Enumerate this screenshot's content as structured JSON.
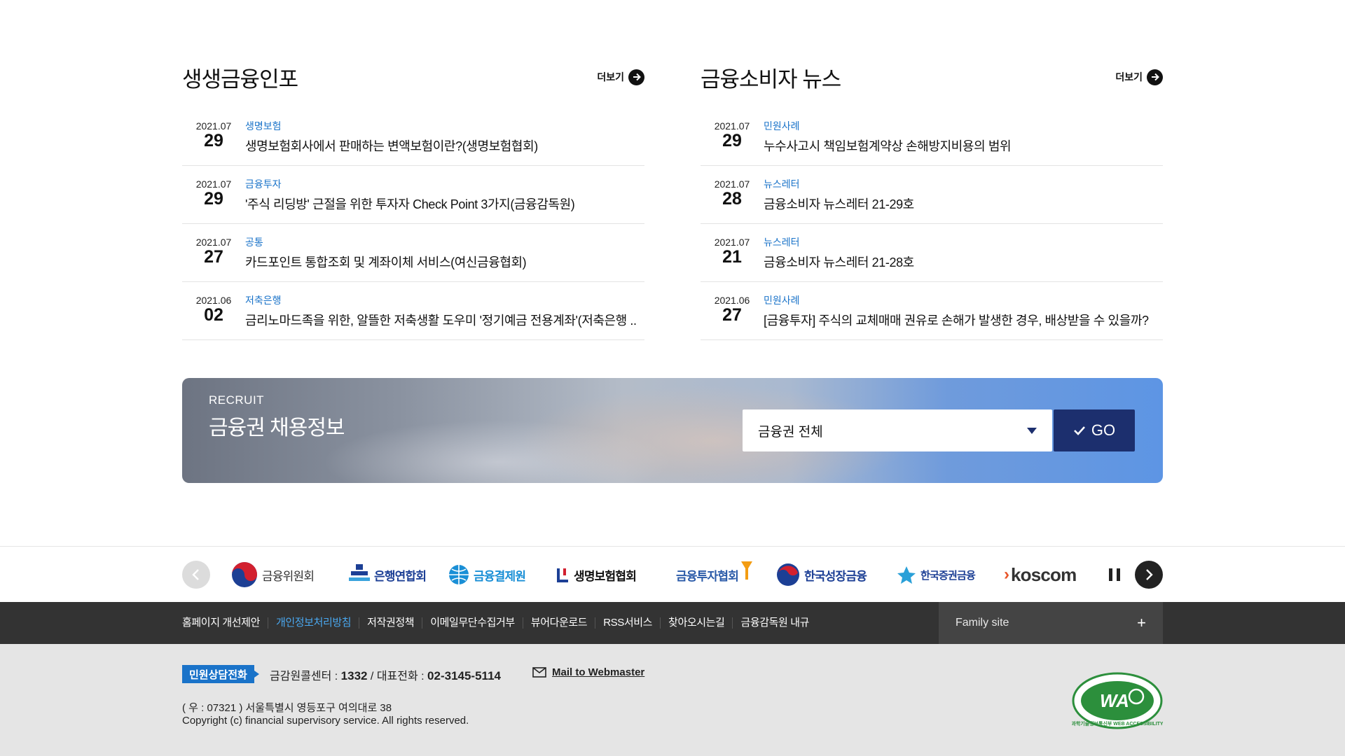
{
  "left_news": {
    "title": "생생금융인포",
    "more_label": "더보기",
    "items": [
      {
        "ym": "2021.07",
        "day": "29",
        "category": "생명보험",
        "text": "생명보험회사에서 판매하는 변액보험이란?(생명보험협회)"
      },
      {
        "ym": "2021.07",
        "day": "29",
        "category": "금융투자",
        "text": "'주식 리딩방' 근절을 위한 투자자 Check Point 3가지(금융감독원)"
      },
      {
        "ym": "2021.07",
        "day": "27",
        "category": "공통",
        "text": "카드포인트 통합조회 및 계좌이체 서비스(여신금융협회)"
      },
      {
        "ym": "2021.06",
        "day": "02",
        "category": "저축은행",
        "text": "금리노마드족을 위한, 알뜰한 저축생활 도우미 '정기예금 전용계좌'(저축은행 .."
      }
    ]
  },
  "right_news": {
    "title": "금융소비자 뉴스",
    "more_label": "더보기",
    "items": [
      {
        "ym": "2021.07",
        "day": "29",
        "category": "민원사례",
        "text": "누수사고시 책임보험계약상 손해방지비용의 범위"
      },
      {
        "ym": "2021.07",
        "day": "28",
        "category": "뉴스레터",
        "text": "금융소비자 뉴스레터 21-29호"
      },
      {
        "ym": "2021.07",
        "day": "21",
        "category": "뉴스레터",
        "text": "금융소비자 뉴스레터 21-28호"
      },
      {
        "ym": "2021.06",
        "day": "27",
        "category": "민원사례",
        "text": "[금융투자] 주식의 교체매매 권유로 손해가 발생한 경우, 배상받을 수 있을까?"
      }
    ]
  },
  "recruit": {
    "subtitle": "RECRUIT",
    "title": "금융권 채용정보",
    "select_value": "금융권 전체",
    "go_label": "GO"
  },
  "partners": {
    "logos": [
      {
        "name": "금융위원회",
        "color": "#333333"
      },
      {
        "name": "은행연합회",
        "color": "#1c3f95"
      },
      {
        "name": "금융결제원",
        "color": "#1a8fd6"
      },
      {
        "name": "생명보험협회",
        "color": "#111111"
      },
      {
        "name": "금융투자협회",
        "color": "#2a5aa8"
      },
      {
        "name": "한국성장금융",
        "color": "#1c3f95"
      },
      {
        "name": "한국증권금융",
        "color": "#1c3f95"
      },
      {
        "name": "koscom",
        "color": "#333333"
      }
    ]
  },
  "footer_nav": {
    "links": [
      "홈페이지 개선제안",
      "개인정보처리방침",
      "저작권정책",
      "이메일무단수집거부",
      "뷰어다운로드",
      "RSS서비스",
      "찾아오시는길",
      "금융감독원 내규"
    ],
    "family_site": "Family site",
    "family_plus": "+"
  },
  "footer_info": {
    "badge": "민원상담전화",
    "callcenter_label": "금감원콜센터 : ",
    "callcenter_number": "1332",
    "separator": " / ",
    "main_label": "대표전화 : ",
    "main_number": "02-3145-5114",
    "mail_label": "Mail to Webmaster",
    "address": "( 우 : 07321 ) 서울특별시 영등포구 여의대로 38",
    "copyright": "Copyright (c) financial supervisory service. All rights reserved.",
    "wa_mark_text": "WA",
    "wa_ring_text": "과학기술정보통신부 WEB ACCESSIBILITY"
  },
  "colors": {
    "accent_blue": "#1a73c9",
    "navy": "#1c2f6e",
    "footer_dark": "#333333",
    "footer_light": "#e5e5e5",
    "nav_highlight": "#4aa8f0"
  }
}
